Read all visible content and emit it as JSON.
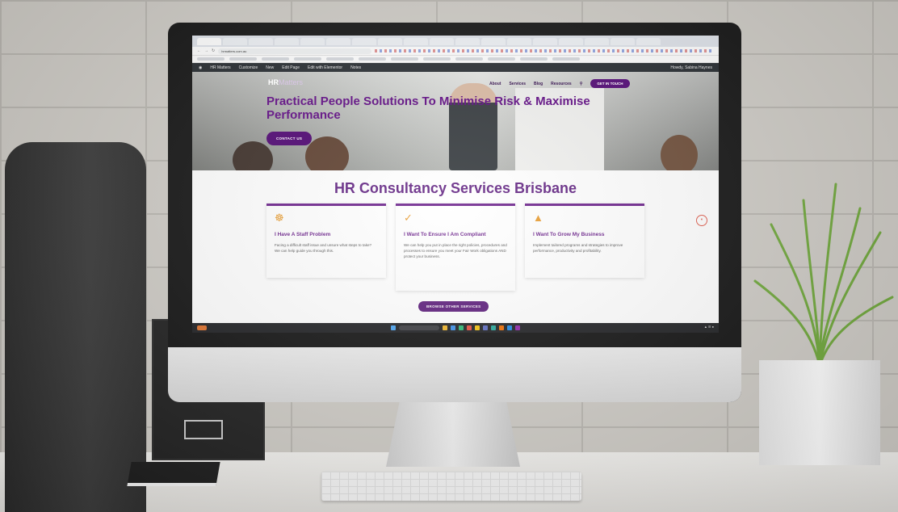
{
  "browser": {
    "tabs": [
      "",
      "",
      "",
      "",
      "",
      "",
      "",
      "",
      "",
      "",
      "",
      "",
      "",
      "",
      "",
      "",
      "",
      ""
    ],
    "url": "hrmatters.com.au"
  },
  "admin_bar": {
    "site": "HR Matters",
    "customize": "Customize",
    "new": "New",
    "edit_page": "Edit Page",
    "elementor": "Edit with Elementor",
    "notes": "Notes",
    "user": "Howdy, Sabina Haynes"
  },
  "site": {
    "logo_main": "HR",
    "logo_sub": "Matters",
    "nav": [
      "About",
      "Services",
      "Blog",
      "Resources"
    ],
    "nav_cta": "GET IN TOUCH",
    "hero_title": "Practical People Solutions To Minimise Risk & Maximise Performance",
    "hero_button": "CONTACT US",
    "section_title": "HR Consultancy Services Brisbane",
    "cards": [
      {
        "icon": "people-icon",
        "title": "I Have A Staff Problem",
        "text": "Facing a difficult staff issue and unsure what steps to take? We can help guide you through this."
      },
      {
        "icon": "check-circle-icon",
        "title": "I Want To Ensure I Am Compliant",
        "text": "We can help you put in place the right policies, procedures and processes to ensure you meet your Fair Work obligations AND protect your business."
      },
      {
        "icon": "growth-chart-icon",
        "title": "I Want To Grow My Business",
        "text": "Implement tailored programs and strategies to improve performance, productivity and profitability."
      }
    ],
    "browse_button": "BROWSE OTHER SERVICES"
  },
  "colors": {
    "brand_purple": "#6a1f8a",
    "button_purple": "#5b1a7a",
    "icon_orange": "#e89a2c"
  }
}
